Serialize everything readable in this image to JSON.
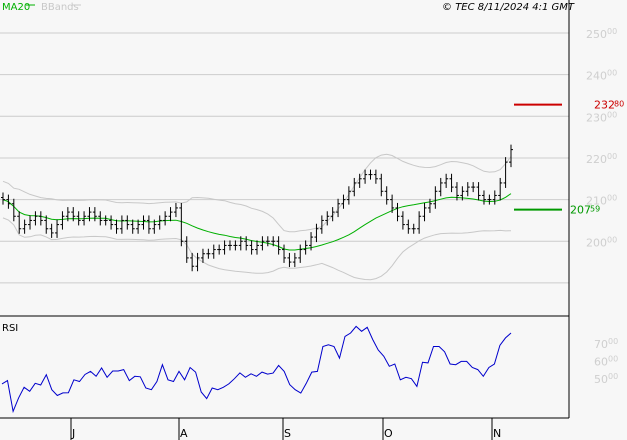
{
  "header": {
    "legend": [
      {
        "label": "MA20",
        "color": "#00b000"
      },
      {
        "label": "BBands",
        "color": "#c8c8c8"
      }
    ],
    "copyright": "© TEC 8/11/2024 4:1 GMT"
  },
  "chart_data": [
    {
      "type": "ohlc",
      "title": "Price",
      "ylim": [
        185,
        257
      ],
      "y_ticks": [
        {
          "value": 250,
          "main": "250",
          "dec": "00"
        },
        {
          "value": 240,
          "main": "240",
          "dec": "00"
        },
        {
          "value": 230,
          "main": "230",
          "dec": "00"
        },
        {
          "value": 220,
          "main": "220",
          "dec": "00"
        },
        {
          "value": 210,
          "main": "210",
          "dec": "00"
        },
        {
          "value": 200,
          "main": "200",
          "dec": "00"
        }
      ],
      "grid_extra": [
        190
      ],
      "x_ticks": [
        {
          "label": "J",
          "index": 12.5
        },
        {
          "label": "A",
          "index": 32.6
        },
        {
          "label": "S",
          "index": 51.9
        },
        {
          "label": "O",
          "index": 70.4
        },
        {
          "label": "N",
          "index": 90.4
        }
      ],
      "close": [
        210,
        209,
        206,
        203,
        204,
        205,
        206,
        205,
        203,
        202,
        204,
        206,
        207,
        206,
        205,
        206,
        207,
        206,
        205,
        205,
        204,
        203,
        205,
        204,
        203,
        204,
        205,
        203,
        204,
        205,
        206,
        207,
        208,
        200,
        196,
        194,
        196,
        197,
        197,
        198,
        198,
        199,
        199,
        199,
        200,
        199,
        198,
        199,
        200,
        200,
        200,
        198,
        196,
        195,
        196,
        198,
        199,
        201,
        203,
        205,
        206,
        207,
        209,
        210,
        212,
        214,
        215,
        216,
        216,
        215,
        212,
        210,
        208,
        206,
        204,
        203,
        203,
        206,
        208,
        209,
        212,
        214,
        215,
        213,
        211,
        212,
        213,
        213,
        211,
        210,
        210,
        211,
        214,
        219,
        222
      ],
      "overlays": [
        "MA20",
        "BBands"
      ],
      "levels": [
        {
          "value": 232.8,
          "main": "232",
          "dec": "80",
          "color": "#cc0000"
        },
        {
          "value": 207.59,
          "main": "207",
          "dec": "59",
          "color": "#009900"
        }
      ]
    },
    {
      "type": "line",
      "title": "RSI",
      "ylim": [
        21,
        85
      ],
      "y_ticks": [
        {
          "value": 70,
          "main": "70",
          "dec": "00"
        },
        {
          "value": 60,
          "main": "60",
          "dec": "00"
        },
        {
          "value": 50,
          "main": "50",
          "dec": "00"
        }
      ],
      "color": "#0000cc",
      "values": [
        46.6,
        48.5,
        31,
        38.6,
        44.7,
        42.4,
        47,
        46,
        51.9,
        43.3,
        40,
        41.5,
        41.6,
        49,
        48,
        52,
        53.8,
        51,
        55.7,
        50.4,
        54,
        54,
        54.8,
        48.5,
        51,
        50.7,
        44.3,
        43.3,
        48,
        57.6,
        49,
        48,
        53.8,
        49,
        56,
        53.4,
        42,
        38.2,
        44.3,
        43.3,
        44.7,
        46.6,
        49.6,
        52.9,
        50.4,
        52.4,
        51,
        53.4,
        52.2,
        52.8,
        57.2,
        53.8,
        46.2,
        43.3,
        41.4,
        47,
        53.4,
        53.8,
        68,
        69,
        68,
        61.4,
        73.8,
        75.7,
        79.5,
        76.7,
        79,
        72,
        66,
        62.4,
        56.7,
        58,
        49,
        50.4,
        49.6,
        45.2,
        59,
        58.6,
        68,
        68,
        65,
        58,
        57.6,
        59.5,
        59.5,
        56,
        54.8,
        51,
        56,
        58,
        68.7,
        72.9,
        75.7
      ]
    }
  ]
}
